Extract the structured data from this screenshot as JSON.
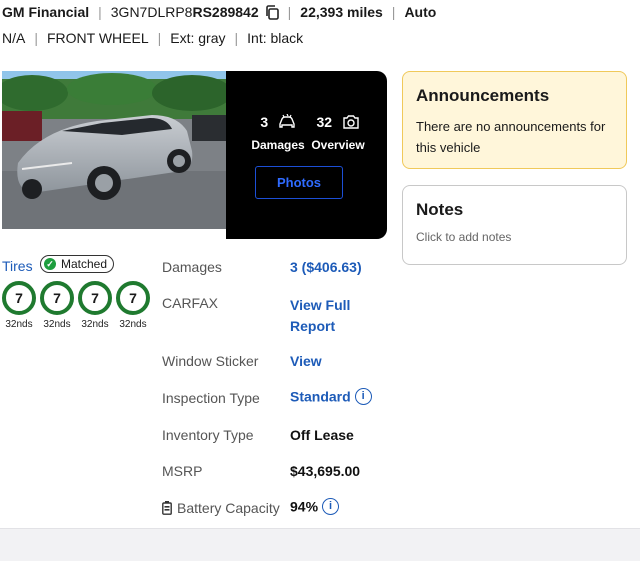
{
  "header": {
    "seller": "GM Financial",
    "vin_prefix": "3GN7DLRP8",
    "vin_suffix": "RS289842",
    "mileage": "22,393 miles",
    "transmission": "Auto",
    "spec1": "N/A",
    "drive": "FRONT WHEEL",
    "exterior": "Ext: gray",
    "interior": "Int: black"
  },
  "media": {
    "damages_count": "3",
    "damages_label": "Damages",
    "overview_count": "32",
    "overview_label": "Overview",
    "photos_button": "Photos"
  },
  "tires": {
    "label": "Tires",
    "matched_label": "Matched",
    "items": [
      {
        "value": "7",
        "depth": "32nds"
      },
      {
        "value": "7",
        "depth": "32nds"
      },
      {
        "value": "7",
        "depth": "32nds"
      },
      {
        "value": "7",
        "depth": "32nds"
      }
    ]
  },
  "details": {
    "damages_label": "Damages",
    "damages_value": "3 ($406.63)",
    "carfax_label": "CARFAX",
    "carfax_value_line1": "View Full",
    "carfax_value_line2": "Report",
    "window_sticker_label": "Window Sticker",
    "window_sticker_value": "View",
    "inspection_type_label": "Inspection Type",
    "inspection_type_value": "Standard",
    "inventory_type_label": "Inventory Type",
    "inventory_type_value": "Off Lease",
    "msrp_label": "MSRP",
    "msrp_value": "$43,695.00",
    "battery_label": "Battery Capacity",
    "battery_value": "94%"
  },
  "announcements": {
    "title": "Announcements",
    "body": "There are no announcements for this vehicle"
  },
  "notes": {
    "title": "Notes",
    "placeholder": "Click to add notes"
  },
  "colors": {
    "link": "#1d5bb8",
    "photos_button_border": "#1c4fd6",
    "tire_ring": "#1f7a2f",
    "announcement_bg": "#fff6da",
    "announcement_border": "#f0c95a"
  }
}
